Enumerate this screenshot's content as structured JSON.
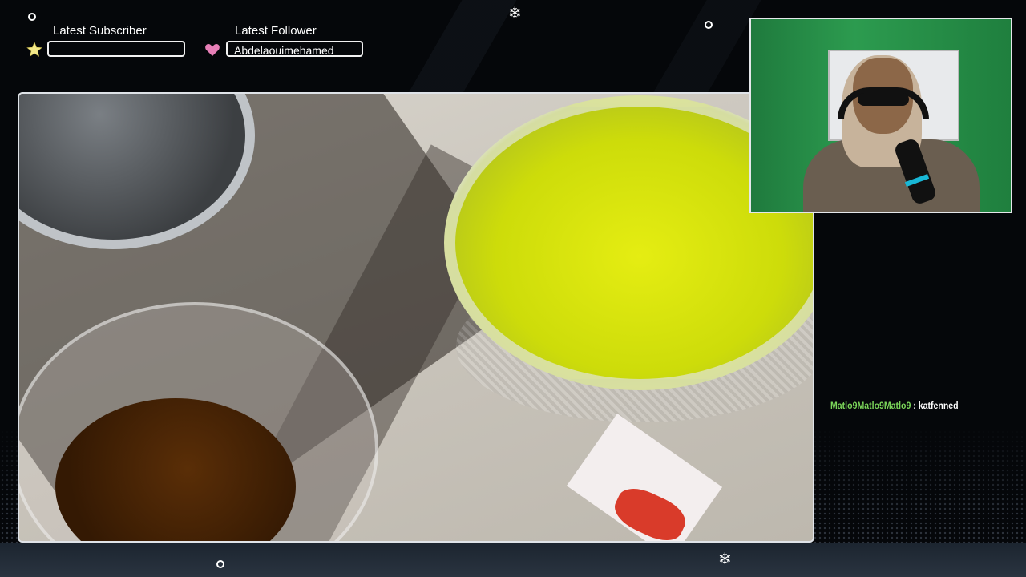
{
  "alerts": {
    "subscriber": {
      "label": "Latest Subscriber",
      "value": "",
      "icon": "star-icon"
    },
    "follower": {
      "label": "Latest Follower",
      "value": "Abdelaouimehamed",
      "icon": "heart-icon"
    }
  },
  "chat": {
    "messages": [
      {
        "user": "Matlo9Matlo9Matlo9",
        "separator": " : ",
        "text": "katfenned"
      }
    ]
  },
  "decorations": {
    "snowflake": "❄"
  },
  "colors": {
    "chat_user": "#7bd65a",
    "frame_border": "#dfe3e8",
    "star": "#f4e98a",
    "heart": "#e77fb7"
  }
}
